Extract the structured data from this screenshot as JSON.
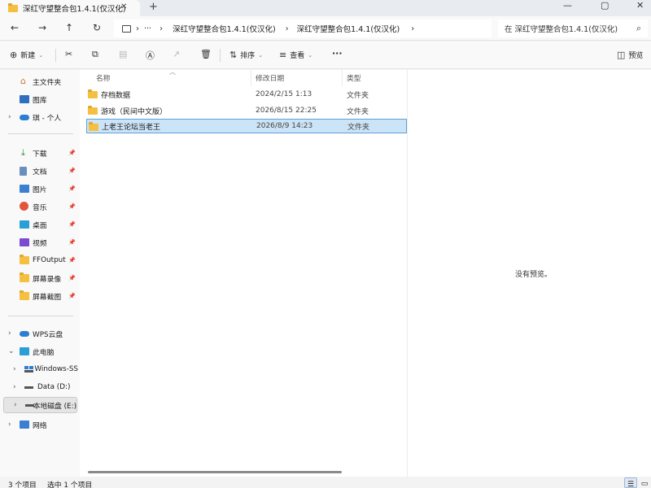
{
  "tab": {
    "title": "深红守望整合包1.4.1(仅汉化)",
    "close_glyph": "✕",
    "new_glyph": "+"
  },
  "window": {
    "min_glyph": "—",
    "max_glyph": "▢",
    "close_glyph": "✕"
  },
  "nav": {
    "back": "←",
    "forward": "→",
    "up": "↑",
    "refresh": "↻",
    "more": "···",
    "breadcrumbs": [
      "深红守望整合包1.4.1(仅汉化)",
      "深红守望整合包1.4.1(仅汉化)"
    ],
    "search_placeholder": "在 深红守望整合包1.4.1(仅汉化)",
    "search_glyph": "⌕"
  },
  "toolbar": {
    "new_label": "新建",
    "sort_label": "排序",
    "view_label": "查看",
    "more_glyph": "···",
    "preview_label": "预览"
  },
  "sidebar": {
    "pinned": [
      {
        "label": "主文件夹",
        "icon": "home-icon"
      },
      {
        "label": "图库",
        "icon": "gallery-icon"
      },
      {
        "label": "琪 - 个人",
        "icon": "cloud-icon"
      }
    ],
    "quick": [
      {
        "label": "下载",
        "icon": "download-icon",
        "color": "#2f8a3b"
      },
      {
        "label": "文档",
        "icon": "document-icon",
        "color": "#6a8fbf"
      },
      {
        "label": "图片",
        "icon": "pictures-icon",
        "color": "#3a7fd0"
      },
      {
        "label": "音乐",
        "icon": "music-icon",
        "color": "#e0553c"
      },
      {
        "label": "桌面",
        "icon": "desktop-icon",
        "color": "#2a9fd6"
      },
      {
        "label": "视频",
        "icon": "video-icon",
        "color": "#7a4bd0"
      },
      {
        "label": "FFOutput",
        "icon": "folder-icon"
      },
      {
        "label": "屏幕录像",
        "icon": "folder-icon"
      },
      {
        "label": "屏幕截图",
        "icon": "folder-icon"
      }
    ],
    "tree": [
      {
        "label": "WPS云盘",
        "icon": "cloud-icon"
      },
      {
        "label": "此电脑",
        "icon": "computer-icon"
      },
      {
        "label": "Windows-SS",
        "icon": "windows-drive-icon"
      },
      {
        "label": "Data (D:)",
        "icon": "drive-icon"
      },
      {
        "label": "本地磁盘 (E:)",
        "icon": "drive-icon"
      },
      {
        "label": "网络",
        "icon": "network-icon"
      }
    ]
  },
  "columns": {
    "name": "名称",
    "date": "修改日期",
    "type": "类型"
  },
  "files": [
    {
      "name": "存档数据",
      "date": "2024/2/15 1:13",
      "type": "文件夹"
    },
    {
      "name": "游戏（民间中文版）",
      "date": "2026/8/15 22:25",
      "type": "文件夹"
    },
    {
      "name": "上老王论坛当老王",
      "date": "2026/8/9 14:23",
      "type": "文件夹"
    }
  ],
  "preview": {
    "message": "没有预览。"
  },
  "status": {
    "count": "3 个项目",
    "selected": "选中 1 个项目"
  },
  "colors": {
    "folder": "#f5c042",
    "selection": "#cce4f7",
    "selection_border": "#5fa0d8"
  }
}
